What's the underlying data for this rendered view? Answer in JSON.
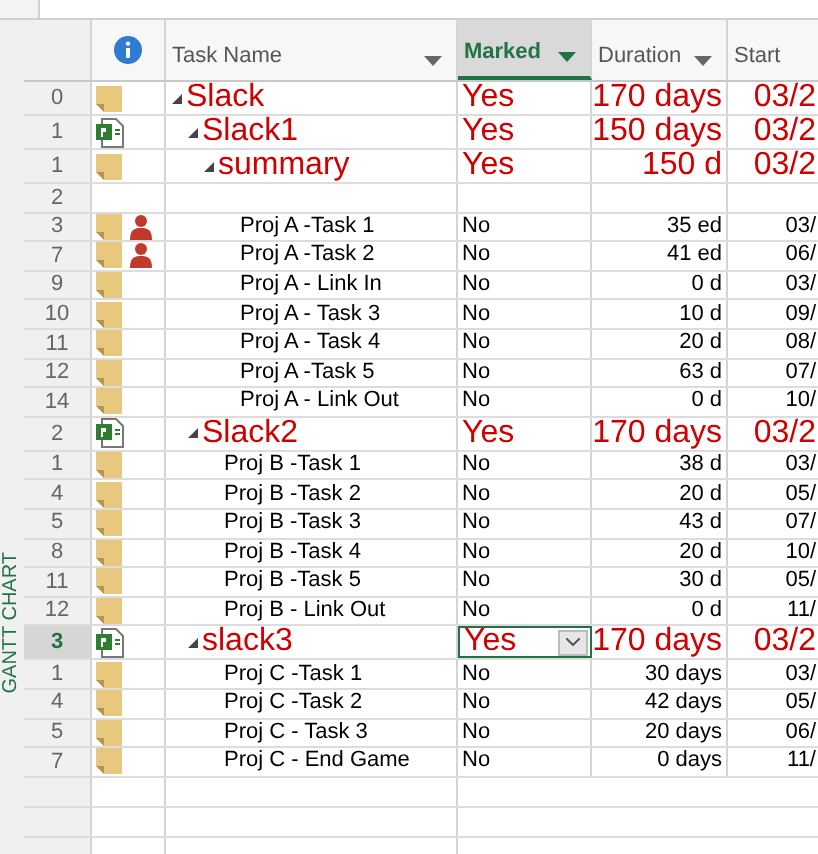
{
  "side_label": "GANTT CHART",
  "columns": [
    {
      "label": "Task Name",
      "filter": true,
      "selected": false
    },
    {
      "label": "Marked",
      "filter": true,
      "selected": true
    },
    {
      "label": "Duration",
      "filter": true,
      "selected": false
    },
    {
      "label": "Start",
      "filter": false,
      "selected": false
    }
  ],
  "rows": [
    {
      "kind": "summary",
      "id": "0",
      "resource": false,
      "selected": false,
      "name": "Slack",
      "marked": "Yes",
      "duration": "170 days",
      "start": "03/2",
      "children": [
        {
          "kind": "subproject",
          "id": "1",
          "resource": false,
          "selected": false,
          "name": "Slack1",
          "marked": "Yes",
          "duration": "150 days",
          "start": "03/2",
          "children": [
            {
              "kind": "summary",
              "id": "1",
              "resource": false,
              "selected": false,
              "name": "summary",
              "marked": "Yes",
              "duration": "150 d",
              "start": "03/2",
              "children": [
                {
                  "kind": "blank",
                  "id": "2",
                  "resource": false,
                  "selected": false
                },
                {
                  "kind": "task",
                  "id": "3",
                  "resource": true,
                  "selected": false,
                  "name": "Proj A -Task 1",
                  "marked": "No",
                  "duration": "35 ed",
                  "start": "03/"
                },
                {
                  "kind": "task",
                  "id": "7",
                  "resource": true,
                  "selected": false,
                  "name": "Proj A -Task 2",
                  "marked": "No",
                  "duration": "41 ed",
                  "start": "06/"
                },
                {
                  "kind": "task",
                  "id": "9",
                  "resource": false,
                  "selected": false,
                  "name": "Proj A - Link In",
                  "marked": "No",
                  "duration": "0 d",
                  "start": "03/"
                },
                {
                  "kind": "task",
                  "id": "10",
                  "resource": false,
                  "selected": false,
                  "name": "Proj A - Task 3",
                  "marked": "No",
                  "duration": "10 d",
                  "start": "09/"
                },
                {
                  "kind": "task",
                  "id": "11",
                  "resource": false,
                  "selected": false,
                  "name": "Proj A - Task 4",
                  "marked": "No",
                  "duration": "20 d",
                  "start": "08/"
                },
                {
                  "kind": "task",
                  "id": "12",
                  "resource": false,
                  "selected": false,
                  "name": "Proj A -Task 5",
                  "marked": "No",
                  "duration": "63 d",
                  "start": "07/"
                },
                {
                  "kind": "task",
                  "id": "14",
                  "resource": false,
                  "selected": false,
                  "name": "Proj A - Link Out",
                  "marked": "No",
                  "duration": "0 d",
                  "start": "10/"
                }
              ]
            }
          ]
        },
        {
          "kind": "subproject",
          "id": "2",
          "resource": false,
          "selected": false,
          "name": "Slack2",
          "marked": "Yes",
          "duration": "170 days",
          "start": "03/2",
          "children": [
            {
              "kind": "task",
              "id": "1",
              "resource": false,
              "selected": false,
              "name": "Proj B -Task 1",
              "marked": "No",
              "duration": "38 d",
              "start": "03/"
            },
            {
              "kind": "task",
              "id": "4",
              "resource": false,
              "selected": false,
              "name": "Proj B -Task 2",
              "marked": "No",
              "duration": "20 d",
              "start": "05/"
            },
            {
              "kind": "task",
              "id": "5",
              "resource": false,
              "selected": false,
              "name": "Proj B -Task 3",
              "marked": "No",
              "duration": "43 d",
              "start": "07/"
            },
            {
              "kind": "task",
              "id": "8",
              "resource": false,
              "selected": false,
              "name": "Proj B -Task 4",
              "marked": "No",
              "duration": "20 d",
              "start": "10/"
            },
            {
              "kind": "task",
              "id": "11",
              "resource": false,
              "selected": false,
              "name": "Proj B -Task 5",
              "marked": "No",
              "duration": "30 d",
              "start": "05/"
            },
            {
              "kind": "task",
              "id": "12",
              "resource": false,
              "selected": false,
              "name": "Proj B - Link Out",
              "marked": "No",
              "duration": "0 d",
              "start": "11/"
            }
          ]
        },
        {
          "kind": "subproject",
          "id": "3",
          "resource": false,
          "selected": true,
          "name": "slack3",
          "marked": "Yes",
          "duration": "170 days",
          "start": "03/2",
          "children": [
            {
              "kind": "task",
              "id": "1",
              "resource": false,
              "selected": false,
              "name": "Proj C -Task 1",
              "marked": "No",
              "duration": "30 days",
              "start": "03/"
            },
            {
              "kind": "task",
              "id": "4",
              "resource": false,
              "selected": false,
              "name": "Proj C -Task 2",
              "marked": "No",
              "duration": "42 days",
              "start": "05/"
            },
            {
              "kind": "task",
              "id": "5",
              "resource": false,
              "selected": false,
              "name": "Proj C - Task 3",
              "marked": "No",
              "duration": "20 days",
              "start": "06/"
            },
            {
              "kind": "task",
              "id": "7",
              "resource": false,
              "selected": false,
              "name": "Proj C - End Game",
              "marked": "No",
              "duration": "0 days",
              "start": "11/"
            }
          ]
        }
      ]
    }
  ]
}
